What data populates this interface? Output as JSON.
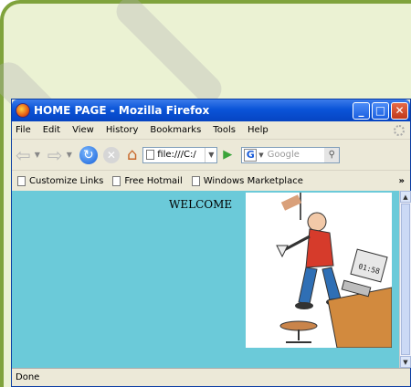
{
  "window": {
    "title": "HOME PAGE - Mozilla Firefox"
  },
  "menu": [
    {
      "u": "F",
      "rest": "ile"
    },
    {
      "u": "E",
      "rest": "dit"
    },
    {
      "u": "V",
      "rest": "iew"
    },
    {
      "u": "",
      "rest": "Hi",
      "u2": "s",
      "rest2": "tory"
    },
    {
      "u": "B",
      "rest": "ookmarks"
    },
    {
      "u": "T",
      "rest": "ools"
    },
    {
      "u": "H",
      "rest": "elp"
    }
  ],
  "menu_labels": {
    "file": "File",
    "edit": "Edit",
    "view": "View",
    "history": "History",
    "bookmarks": "Bookmarks",
    "tools": "Tools",
    "help": "Help"
  },
  "address": {
    "value": "file:///C:/"
  },
  "search": {
    "placeholder": "Google",
    "engine_letter": "G"
  },
  "bookmarks": [
    {
      "label": "Customize Links"
    },
    {
      "label": "Free Hotmail"
    },
    {
      "label": "Windows Marketplace"
    }
  ],
  "page": {
    "heading": "WELCOME"
  },
  "status": {
    "text": "Done"
  },
  "icons": {
    "overflow": "»",
    "back": "⇦",
    "forward": "⇨",
    "reload": "↻",
    "stop": "✕",
    "home": "⌂",
    "go": "▶",
    "minimize": "_",
    "maximize": "□",
    "close": "✕"
  },
  "colors": {
    "page_bg": "#6bcad9",
    "titlebar": "#0a54d8"
  }
}
